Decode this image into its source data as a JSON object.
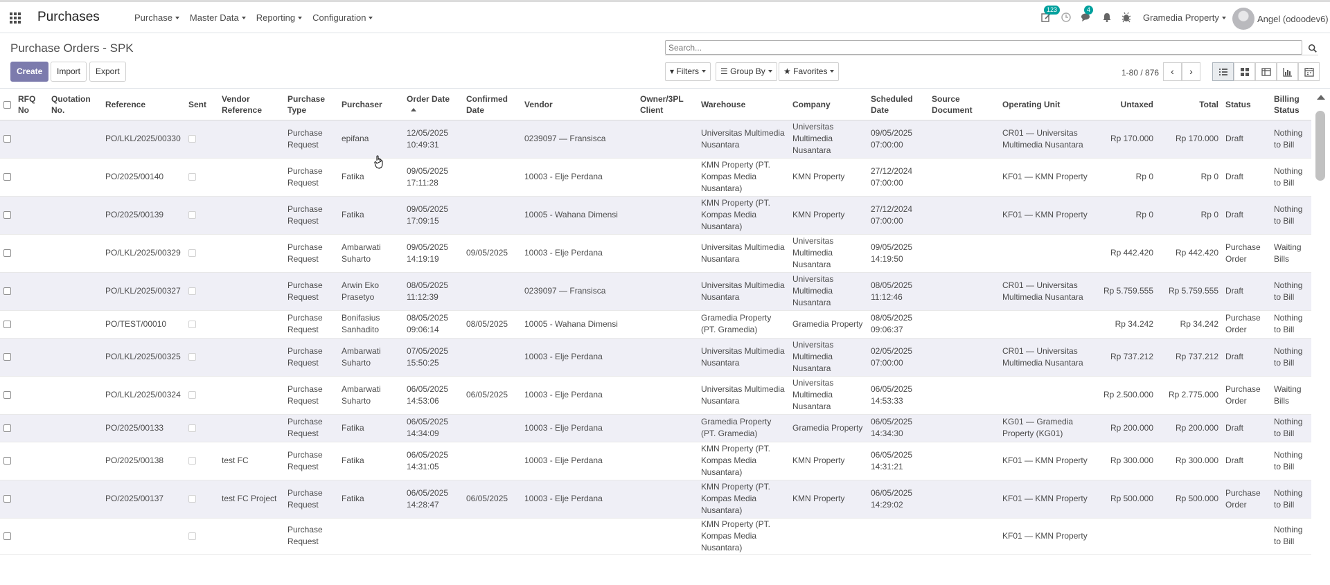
{
  "navbar": {
    "app_title": "Purchases",
    "menu": [
      "Purchase",
      "Master Data",
      "Reporting",
      "Configuration"
    ],
    "activity_badge": "123",
    "chat_badge": "4",
    "company": "Gramedia Property",
    "user": "Angel (odoodev6)"
  },
  "control_panel": {
    "breadcrumb": "Purchase Orders - SPK",
    "create": "Create",
    "import": "Import",
    "export": "Export",
    "search_placeholder": "Search...",
    "filters": "Filters",
    "group_by": "Group By",
    "favorites": "Favorites",
    "pager": "1-80 / 876"
  },
  "table": {
    "columns": [
      "RFQ No",
      "Quotation No.",
      "Reference",
      "Sent",
      "Vendor Reference",
      "Purchase Type",
      "Purchaser",
      "Order Date",
      "Confirmed Date",
      "Vendor",
      "Owner/3PL Client",
      "Warehouse",
      "Company",
      "Scheduled Date",
      "Source Document",
      "Operating Unit",
      "Untaxed",
      "Total",
      "Status",
      "Billing Status"
    ],
    "rows": [
      {
        "ref": "PO/LKL/2025/00330",
        "vendor_ref": "",
        "type": "Purchase Request",
        "purchaser": "epifana",
        "order_date": "12/05/2025 10:49:31",
        "confirmed": "",
        "vendor": "0239097 — Fransisca",
        "owner": "",
        "warehouse": "Universitas Multimedia Nusantara",
        "company": "Universitas Multimedia Nusantara",
        "scheduled": "09/05/2025 07:00:00",
        "source": "",
        "ou": "CR01 — Universitas Multimedia Nusantara",
        "untaxed": "Rp 170.000",
        "total": "Rp 170.000",
        "status": "Draft",
        "billing": "Nothing to Bill"
      },
      {
        "ref": "PO/2025/00140",
        "vendor_ref": "",
        "type": "Purchase Request",
        "purchaser": "Fatika",
        "order_date": "09/05/2025 17:11:28",
        "confirmed": "",
        "vendor": "10003 - Elje Perdana",
        "owner": "",
        "warehouse": "KMN Property (PT. Kompas Media Nusantara)",
        "company": "KMN Property",
        "scheduled": "27/12/2024 07:00:00",
        "source": "",
        "ou": "KF01 — KMN Property",
        "untaxed": "Rp 0",
        "total": "Rp 0",
        "status": "Draft",
        "billing": "Nothing to Bill"
      },
      {
        "ref": "PO/2025/00139",
        "vendor_ref": "",
        "type": "Purchase Request",
        "purchaser": "Fatika",
        "order_date": "09/05/2025 17:09:15",
        "confirmed": "",
        "vendor": "10005 - Wahana Dimensi",
        "owner": "",
        "warehouse": "KMN Property (PT. Kompas Media Nusantara)",
        "company": "KMN Property",
        "scheduled": "27/12/2024 07:00:00",
        "source": "",
        "ou": "KF01 — KMN Property",
        "untaxed": "Rp 0",
        "total": "Rp 0",
        "status": "Draft",
        "billing": "Nothing to Bill"
      },
      {
        "ref": "PO/LKL/2025/00329",
        "vendor_ref": "",
        "type": "Purchase Request",
        "purchaser": "Ambarwati Suharto",
        "order_date": "09/05/2025 14:19:19",
        "confirmed": "09/05/2025",
        "vendor": "10003 - Elje Perdana",
        "owner": "",
        "warehouse": "Universitas Multimedia Nusantara",
        "company": "Universitas Multimedia Nusantara",
        "scheduled": "09/05/2025 14:19:50",
        "source": "",
        "ou": "",
        "untaxed": "Rp 442.420",
        "total": "Rp 442.420",
        "status": "Purchase Order",
        "billing": "Waiting Bills"
      },
      {
        "ref": "PO/LKL/2025/00327",
        "vendor_ref": "",
        "type": "Purchase Request",
        "purchaser": "Arwin Eko Prasetyo",
        "order_date": "08/05/2025 11:12:39",
        "confirmed": "",
        "vendor": "0239097 — Fransisca",
        "owner": "",
        "warehouse": "Universitas Multimedia Nusantara",
        "company": "Universitas Multimedia Nusantara",
        "scheduled": "08/05/2025 11:12:46",
        "source": "",
        "ou": "CR01 — Universitas Multimedia Nusantara",
        "untaxed": "Rp 5.759.555",
        "total": "Rp 5.759.555",
        "status": "Draft",
        "billing": "Nothing to Bill"
      },
      {
        "ref": "PO/TEST/00010",
        "vendor_ref": "",
        "type": "Purchase Request",
        "purchaser": "Bonifasius Sanhadito",
        "order_date": "08/05/2025 09:06:14",
        "confirmed": "08/05/2025",
        "vendor": "10005 - Wahana Dimensi",
        "owner": "",
        "warehouse": "Gramedia Property (PT. Gramedia)",
        "company": "Gramedia Property",
        "scheduled": "08/05/2025 09:06:37",
        "source": "",
        "ou": "",
        "untaxed": "Rp 34.242",
        "total": "Rp 34.242",
        "status": "Purchase Order",
        "billing": "Nothing to Bill"
      },
      {
        "ref": "PO/LKL/2025/00325",
        "vendor_ref": "",
        "type": "Purchase Request",
        "purchaser": "Ambarwati Suharto",
        "order_date": "07/05/2025 15:50:25",
        "confirmed": "",
        "vendor": "10003 - Elje Perdana",
        "owner": "",
        "warehouse": "Universitas Multimedia Nusantara",
        "company": "Universitas Multimedia Nusantara",
        "scheduled": "02/05/2025 07:00:00",
        "source": "",
        "ou": "CR01 — Universitas Multimedia Nusantara",
        "untaxed": "Rp 737.212",
        "total": "Rp 737.212",
        "status": "Draft",
        "billing": "Nothing to Bill"
      },
      {
        "ref": "PO/LKL/2025/00324",
        "vendor_ref": "",
        "type": "Purchase Request",
        "purchaser": "Ambarwati Suharto",
        "order_date": "06/05/2025 14:53:06",
        "confirmed": "06/05/2025",
        "vendor": "10003 - Elje Perdana",
        "owner": "",
        "warehouse": "Universitas Multimedia Nusantara",
        "company": "Universitas Multimedia Nusantara",
        "scheduled": "06/05/2025 14:53:33",
        "source": "",
        "ou": "",
        "untaxed": "Rp 2.500.000",
        "total": "Rp 2.775.000",
        "status": "Purchase Order",
        "billing": "Waiting Bills"
      },
      {
        "ref": "PO/2025/00133",
        "vendor_ref": "",
        "type": "Purchase Request",
        "purchaser": "Fatika",
        "order_date": "06/05/2025 14:34:09",
        "confirmed": "",
        "vendor": "10003 - Elje Perdana",
        "owner": "",
        "warehouse": "Gramedia Property (PT. Gramedia)",
        "company": "Gramedia Property",
        "scheduled": "06/05/2025 14:34:30",
        "source": "",
        "ou": "KG01 — Gramedia Property (KG01)",
        "untaxed": "Rp 200.000",
        "total": "Rp 200.000",
        "status": "Draft",
        "billing": "Nothing to Bill"
      },
      {
        "ref": "PO/2025/00138",
        "vendor_ref": "test FC",
        "type": "Purchase Request",
        "purchaser": "Fatika",
        "order_date": "06/05/2025 14:31:05",
        "confirmed": "",
        "vendor": "10003 - Elje Perdana",
        "owner": "",
        "warehouse": "KMN Property (PT. Kompas Media Nusantara)",
        "company": "KMN Property",
        "scheduled": "06/05/2025 14:31:21",
        "source": "",
        "ou": "KF01 — KMN Property",
        "untaxed": "Rp 300.000",
        "total": "Rp 300.000",
        "status": "Draft",
        "billing": "Nothing to Bill"
      },
      {
        "ref": "PO/2025/00137",
        "vendor_ref": "test FC Project",
        "type": "Purchase Request",
        "purchaser": "Fatika",
        "order_date": "06/05/2025 14:28:47",
        "confirmed": "06/05/2025",
        "vendor": "10003 - Elje Perdana",
        "owner": "",
        "warehouse": "KMN Property (PT. Kompas Media Nusantara)",
        "company": "KMN Property",
        "scheduled": "06/05/2025 14:29:02",
        "source": "",
        "ou": "KF01 — KMN Property",
        "untaxed": "Rp 500.000",
        "total": "Rp 500.000",
        "status": "Purchase Order",
        "billing": "Nothing to Bill"
      },
      {
        "ref": "",
        "vendor_ref": "",
        "type": "Purchase Request",
        "purchaser": "",
        "order_date": "",
        "confirmed": "",
        "vendor": "",
        "owner": "",
        "warehouse": "KMN Property (PT. Kompas Media Nusantara)",
        "company": "",
        "scheduled": "",
        "source": "",
        "ou": "KF01 — KMN Property",
        "untaxed": "",
        "total": "",
        "status": "",
        "billing": "Nothing to Bill"
      }
    ]
  }
}
